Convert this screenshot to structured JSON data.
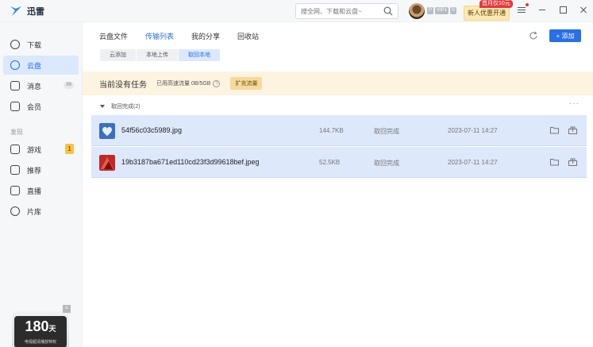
{
  "app": {
    "name": "迅雷"
  },
  "topbar": {
    "search_placeholder": "搜全网、下载和云盘~",
    "vip_badges": [
      "P",
      "VIP1",
      "S"
    ],
    "promo_tag": "首月仅10元",
    "promo_button": "新人优惠开通"
  },
  "sidebar": {
    "items": [
      {
        "label": "下载",
        "icon": "download-icon"
      },
      {
        "label": "云盘",
        "icon": "cloud-icon"
      },
      {
        "label": "消息",
        "icon": "message-icon",
        "badge": "99"
      },
      {
        "label": "会员",
        "icon": "crown-icon"
      }
    ],
    "section_label": "发现",
    "discover_items": [
      {
        "label": "游戏",
        "icon": "gamepad-icon",
        "badge": "1"
      },
      {
        "label": "推荐",
        "icon": "recommend-icon"
      },
      {
        "label": "直播",
        "icon": "live-icon"
      },
      {
        "label": "片库",
        "icon": "film-icon"
      }
    ],
    "ad": {
      "number": "180",
      "unit": "天",
      "caption": "电视超清播放特权",
      "close": "×"
    }
  },
  "main": {
    "tabs": [
      {
        "label": "云盘文件",
        "active": false
      },
      {
        "label": "传输列表",
        "active": true
      },
      {
        "label": "我的分享",
        "active": false
      },
      {
        "label": "回收站",
        "active": false
      }
    ],
    "add_button": "+ 添加",
    "subtabs": [
      {
        "label": "云添加",
        "active": false
      },
      {
        "label": "本地上传",
        "active": false
      },
      {
        "label": "取回本地",
        "active": true
      }
    ],
    "banner": {
      "title": "当前没有任务",
      "quota": "已用高速流量 0B/5GB",
      "help": "?",
      "expand_button": "扩充流量"
    },
    "group": {
      "label": "取回完成(2)",
      "more": "···"
    },
    "files": [
      {
        "name": "54f56c03c5989.jpg",
        "size": "144.7KB",
        "status": "取回完成",
        "time": "2023-07-11 14:27"
      },
      {
        "name": "19b3187ba671ed110cd23f3d99618bef.jpeg",
        "size": "52.5KB",
        "status": "取回完成",
        "time": "2023-07-11 14:27"
      }
    ]
  },
  "colors": {
    "accent": "#2a6ee8",
    "row_bg": "#dde8fb",
    "banner_bg": "#fdf3e1"
  }
}
